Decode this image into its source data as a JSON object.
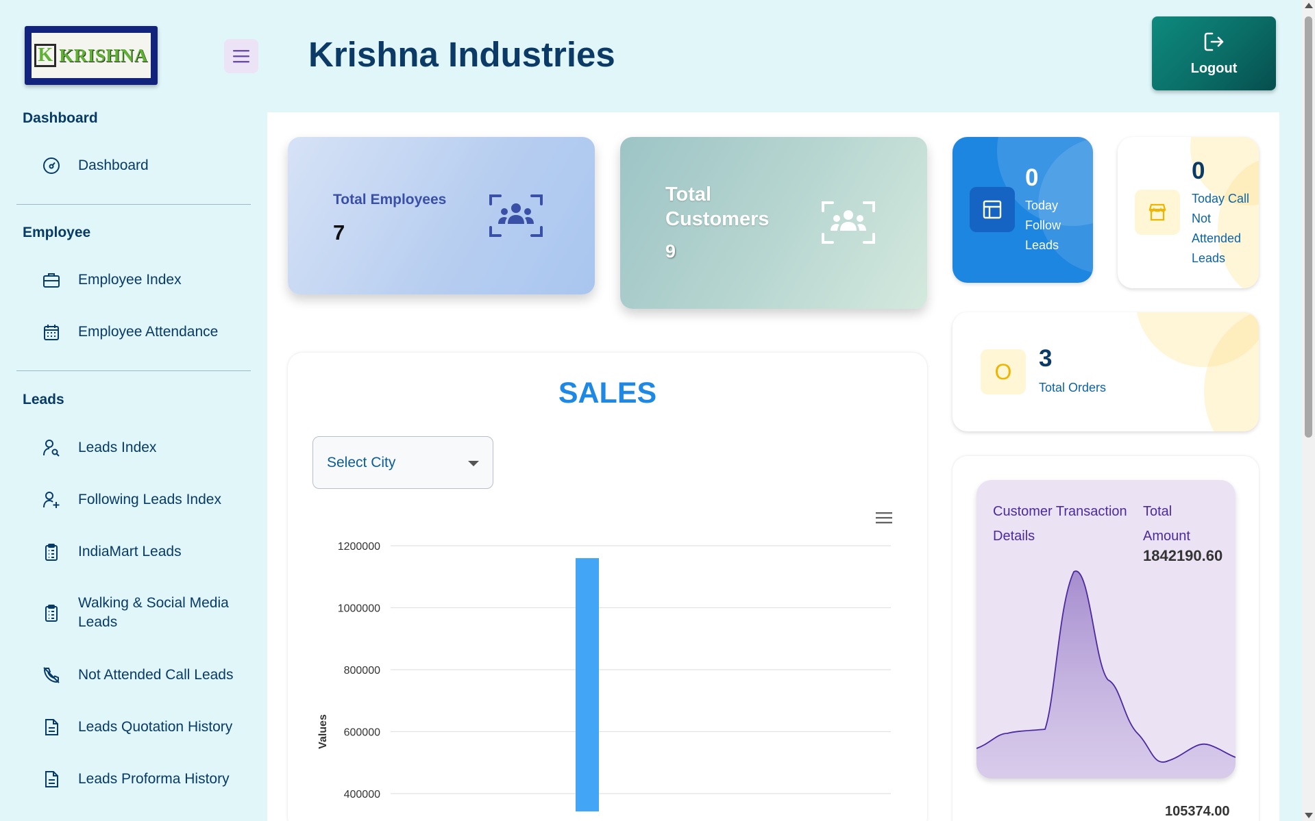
{
  "app": {
    "logo_text": "KRISHNA",
    "title": "Krishna Industries",
    "logout_label": "Logout"
  },
  "sidebar": {
    "sections": [
      {
        "title": "Dashboard",
        "items": [
          {
            "label": "Dashboard",
            "icon": "gauge-icon"
          }
        ]
      },
      {
        "title": "Employee",
        "items": [
          {
            "label": "Employee Index",
            "icon": "briefcase-icon"
          },
          {
            "label": "Employee Attendance",
            "icon": "calendar-icon"
          }
        ]
      },
      {
        "title": "Leads",
        "items": [
          {
            "label": "Leads Index",
            "icon": "user-search-icon"
          },
          {
            "label": "Following Leads Index",
            "icon": "user-plus-icon"
          },
          {
            "label": "IndiaMart Leads",
            "icon": "clipboard-list-icon"
          },
          {
            "label": "Walking & Social Media Leads",
            "icon": "clipboard-list-icon"
          },
          {
            "label": "Not Attended Call Leads",
            "icon": "phone-off-icon"
          },
          {
            "label": "Leads Quotation History",
            "icon": "file-text-icon"
          },
          {
            "label": "Leads Proforma History",
            "icon": "file-text-icon"
          }
        ]
      }
    ]
  },
  "cards": {
    "total_employees": {
      "label": "Total Employees",
      "value": "7",
      "icon": "users-scan-icon"
    },
    "total_customers": {
      "label": "Total Customers",
      "value": "9",
      "icon": "users-scan-icon"
    },
    "today_follow": {
      "value": "0",
      "label": "Today Follow Leads",
      "icon": "table-icon"
    },
    "today_not_attended": {
      "value": "0",
      "label": "Today Call Not Attended Leads",
      "icon": "store-icon"
    },
    "total_orders": {
      "icon_text": "O",
      "value": "3",
      "label": "Total Orders"
    }
  },
  "sales": {
    "title": "SALES",
    "select_city_placeholder": "Select City"
  },
  "chart_data": {
    "type": "bar",
    "title": "",
    "ylabel": "Values",
    "ylim": [
      200000,
      1200000
    ],
    "yticks": [
      "1200000",
      "1000000",
      "800000",
      "600000",
      "400000"
    ],
    "series": [
      {
        "values": [
          1160000
        ]
      }
    ],
    "colors": {
      "bar": "#42a5f5"
    }
  },
  "transactions": {
    "title": "Customer Transaction Details",
    "amount_label": "Total Amount",
    "amount_value": "1842190.60",
    "next_value": "105374.00"
  },
  "colors": {
    "background": "#e0f6f9",
    "primary_text": "#0b3a66",
    "accent_blue": "#1e88e5",
    "logout": "#0a6d66",
    "purple": "#4b2aa0"
  }
}
